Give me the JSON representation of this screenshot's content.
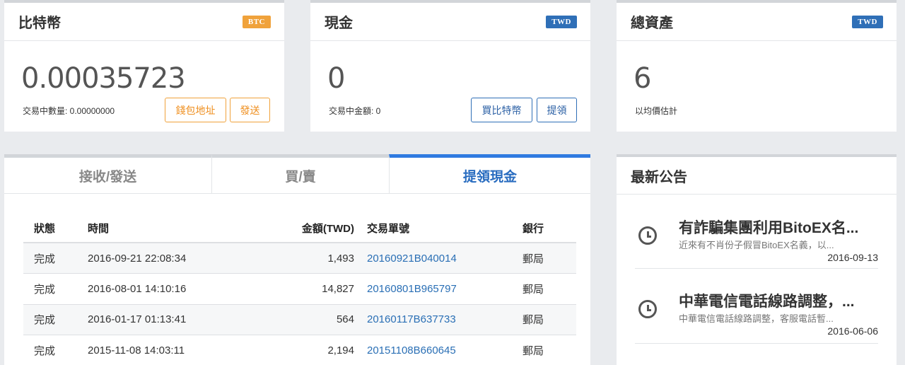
{
  "bitcoin_card": {
    "title": "比特幣",
    "badge": "BTC",
    "value": "0.00035723",
    "sub_label": "交易中數量: 0.00000000",
    "buttons": [
      "錢包地址",
      "發送"
    ]
  },
  "cash_card": {
    "title": "現金",
    "badge": "TWD",
    "value": "0",
    "sub_label": "交易中金額: 0",
    "buttons": [
      "買比特幣",
      "提領"
    ]
  },
  "total_card": {
    "title": "總資產",
    "badge": "TWD",
    "value": "6",
    "sub_label": "以均價估計"
  },
  "tabs": [
    {
      "label": "接收/發送",
      "active": false
    },
    {
      "label": "買/賣",
      "active": false
    },
    {
      "label": "提領現金",
      "active": true
    }
  ],
  "table": {
    "headers": [
      "狀態",
      "時間",
      "金額(TWD)",
      "交易單號",
      "銀行"
    ],
    "rows": [
      [
        "完成",
        "2016-09-21 22:08:34",
        "1,493",
        "20160921B040014",
        "郵局"
      ],
      [
        "完成",
        "2016-08-01 14:10:16",
        "14,827",
        "20160801B965797",
        "郵局"
      ],
      [
        "完成",
        "2016-01-17 01:13:41",
        "564",
        "20160117B637733",
        "郵局"
      ],
      [
        "完成",
        "2015-11-08 14:03:11",
        "2,194",
        "20151108B660645",
        "郵局"
      ]
    ]
  },
  "announcements": {
    "title": "最新公告",
    "items": [
      {
        "title": "有詐騙集團利用BitoEX名...",
        "body": "近來有不肖份子假冒BitoEX名義，以...",
        "date": "2016-09-13"
      },
      {
        "title": "中華電信電話線路調整，...",
        "body": "中華電信電話線路調整，客服電話暫...",
        "date": "2016-06-06"
      }
    ]
  },
  "colors": {
    "btc_badge": "#f0a23b",
    "twd_badge": "#2f6fb7",
    "active_tab": "#2f7ae0",
    "link": "#2a6fb5"
  }
}
